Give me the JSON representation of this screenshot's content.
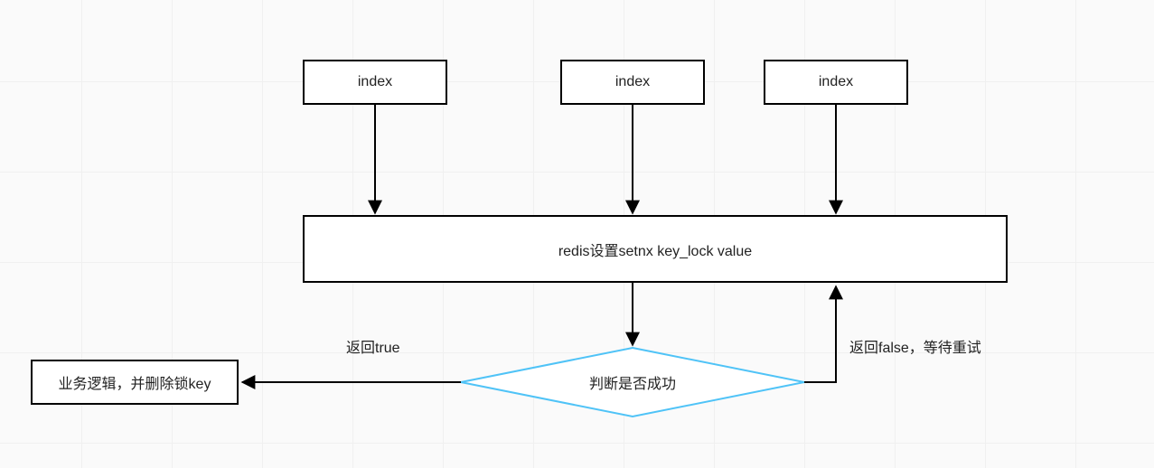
{
  "nodes": {
    "index1": "index",
    "index2": "index",
    "index3": "index",
    "redis": "redis设置setnx key_lock value",
    "decision": "判断是否成功",
    "business": "业务逻辑，并删除锁key"
  },
  "edges": {
    "trueLabel": "返回true",
    "falseLabel": "返回false，等待重试"
  }
}
